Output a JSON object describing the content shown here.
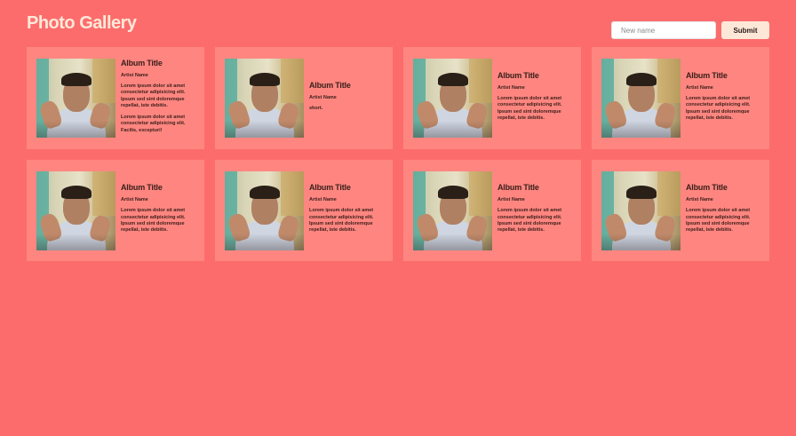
{
  "header": {
    "title": "Photo Gallery",
    "input_placeholder": "New name",
    "input_value": "",
    "submit_label": "Submit"
  },
  "colors": {
    "background": "#fd6c6c",
    "card": "#ff8680",
    "title": "#fde8d8",
    "text": "#3a1e1a"
  },
  "albums": [
    {
      "title": "Album Title",
      "artist": "Artist Name",
      "paragraphs": [
        "Lorem ipsum dolor sit amet consectetur adipisicing elit. Ipsum sed sint doloremque repellat, iste debitis.",
        "Lorem ipsum dolor sit amet consectetur adipisicing elit. Facilis, excepturi!"
      ],
      "image": "portrait-photo"
    },
    {
      "title": "Album Title",
      "artist": "Artist Name",
      "paragraphs": [
        "short."
      ],
      "image": "portrait-photo"
    },
    {
      "title": "Album Title",
      "artist": "Artist Name",
      "paragraphs": [
        "Lorem ipsum dolor sit amet consectetur adipisicing elit. Ipsum sed sint doloremque repellat, iste debitis."
      ],
      "image": "portrait-photo"
    },
    {
      "title": "Album Title",
      "artist": "Artist Name",
      "paragraphs": [
        "Lorem ipsum dolor sit amet consectetur adipisicing elit. Ipsum sed sint doloremque repellat, iste debitis."
      ],
      "image": "portrait-photo"
    },
    {
      "title": "Album Title",
      "artist": "Artist Name",
      "paragraphs": [
        "Lorem ipsum dolor sit amet consectetur adipisicing elit. Ipsum sed sint doloremque repellat, iste debitis."
      ],
      "image": "portrait-photo"
    },
    {
      "title": "Album Title",
      "artist": "Artist Name",
      "paragraphs": [
        "Lorem ipsum dolor sit amet consectetur adipisicing elit. Ipsum sed sint doloremque repellat, iste debitis."
      ],
      "image": "portrait-photo"
    },
    {
      "title": "Album Title",
      "artist": "Artist Name",
      "paragraphs": [
        "Lorem ipsum dolor sit amet consectetur adipisicing elit. Ipsum sed sint doloremque repellat, iste debitis."
      ],
      "image": "portrait-photo"
    },
    {
      "title": "Album Title",
      "artist": "Artist Name",
      "paragraphs": [
        "Lorem ipsum dolor sit amet consectetur adipisicing elit. Ipsum sed sint doloremque repellat, iste debitis."
      ],
      "image": "portrait-photo"
    }
  ]
}
